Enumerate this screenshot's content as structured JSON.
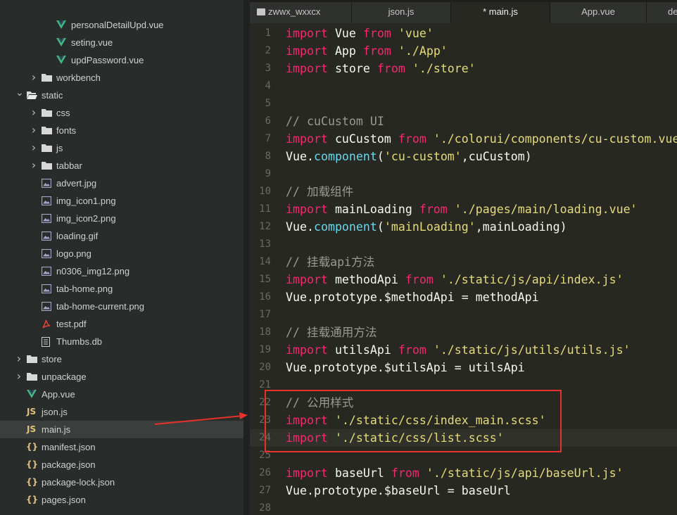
{
  "sidebar": {
    "items": [
      {
        "label": "personalDetailUpd.vue",
        "icon": "vue-icon",
        "indent": 3,
        "arrow": ""
      },
      {
        "label": "seting.vue",
        "icon": "vue-icon",
        "indent": 3,
        "arrow": ""
      },
      {
        "label": "updPassword.vue",
        "icon": "vue-icon",
        "indent": 3,
        "arrow": ""
      },
      {
        "label": "workbench",
        "icon": "folder-icon",
        "indent": 2,
        "arrow": "right"
      },
      {
        "label": "static",
        "icon": "folder-open-icon",
        "indent": 1,
        "arrow": "down"
      },
      {
        "label": "css",
        "icon": "folder-icon",
        "indent": 2,
        "arrow": "right"
      },
      {
        "label": "fonts",
        "icon": "folder-icon",
        "indent": 2,
        "arrow": "right"
      },
      {
        "label": "js",
        "icon": "folder-icon",
        "indent": 2,
        "arrow": "right"
      },
      {
        "label": "tabbar",
        "icon": "folder-icon",
        "indent": 2,
        "arrow": "right"
      },
      {
        "label": "advert.jpg",
        "icon": "image-icon",
        "indent": 2,
        "arrow": ""
      },
      {
        "label": "img_icon1.png",
        "icon": "image-icon",
        "indent": 2,
        "arrow": ""
      },
      {
        "label": "img_icon2.png",
        "icon": "image-icon",
        "indent": 2,
        "arrow": ""
      },
      {
        "label": "loading.gif",
        "icon": "image-icon",
        "indent": 2,
        "arrow": ""
      },
      {
        "label": "logo.png",
        "icon": "image-icon",
        "indent": 2,
        "arrow": ""
      },
      {
        "label": "n0306_img12.png",
        "icon": "image-icon",
        "indent": 2,
        "arrow": ""
      },
      {
        "label": "tab-home.png",
        "icon": "image-icon",
        "indent": 2,
        "arrow": ""
      },
      {
        "label": "tab-home-current.png",
        "icon": "image-icon",
        "indent": 2,
        "arrow": ""
      },
      {
        "label": "test.pdf",
        "icon": "pdf-icon",
        "indent": 2,
        "arrow": ""
      },
      {
        "label": "Thumbs.db",
        "icon": "file-icon",
        "indent": 2,
        "arrow": ""
      },
      {
        "label": "store",
        "icon": "folder-icon",
        "indent": 1,
        "arrow": "right"
      },
      {
        "label": "unpackage",
        "icon": "folder-icon",
        "indent": 1,
        "arrow": "right"
      },
      {
        "label": "App.vue",
        "icon": "vue-icon",
        "indent": 1,
        "arrow": ""
      },
      {
        "label": "json.js",
        "icon": "js-icon",
        "indent": 1,
        "arrow": ""
      },
      {
        "label": "main.js",
        "icon": "js-icon",
        "indent": 1,
        "arrow": "",
        "selected": true
      },
      {
        "label": "manifest.json",
        "icon": "json-icon",
        "indent": 1,
        "arrow": ""
      },
      {
        "label": "package.json",
        "icon": "json-icon",
        "indent": 1,
        "arrow": ""
      },
      {
        "label": "package-lock.json",
        "icon": "json-icon",
        "indent": 1,
        "arrow": ""
      },
      {
        "label": "pages.json",
        "icon": "json-icon",
        "indent": 1,
        "arrow": ""
      }
    ]
  },
  "tabs": [
    {
      "label": "zwwx_wxxcx",
      "icon": "folder-icon",
      "active": false
    },
    {
      "label": "json.js",
      "icon": "",
      "active": false
    },
    {
      "label": "* main.js",
      "icon": "",
      "active": true
    },
    {
      "label": "App.vue",
      "icon": "",
      "active": false
    },
    {
      "label": "de",
      "icon": "",
      "active": false
    }
  ],
  "editor": {
    "active_line": 24,
    "lines": [
      {
        "n": "1",
        "t": [
          [
            "kw",
            "import"
          ],
          [
            "p",
            " Vue "
          ],
          [
            "kw",
            "from"
          ],
          [
            "p",
            " "
          ],
          [
            "str",
            "'vue'"
          ]
        ]
      },
      {
        "n": "2",
        "t": [
          [
            "kw",
            "import"
          ],
          [
            "p",
            " App "
          ],
          [
            "kw",
            "from"
          ],
          [
            "p",
            " "
          ],
          [
            "str",
            "'./App'"
          ]
        ]
      },
      {
        "n": "3",
        "t": [
          [
            "kw",
            "import"
          ],
          [
            "p",
            " store "
          ],
          [
            "kw",
            "from"
          ],
          [
            "p",
            " "
          ],
          [
            "str",
            "'./store'"
          ]
        ]
      },
      {
        "n": "4",
        "t": []
      },
      {
        "n": "5",
        "t": []
      },
      {
        "n": "6",
        "t": [
          [
            "cm",
            "// cuCustom UI"
          ]
        ]
      },
      {
        "n": "7",
        "t": [
          [
            "kw",
            "import"
          ],
          [
            "p",
            " cuCustom "
          ],
          [
            "kw",
            "from"
          ],
          [
            "p",
            " "
          ],
          [
            "str",
            "'./colorui/components/cu-custom.vue'"
          ]
        ]
      },
      {
        "n": "8",
        "t": [
          [
            "p",
            "Vue."
          ],
          [
            "fn",
            "component"
          ],
          [
            "p",
            "("
          ],
          [
            "str",
            "'cu-custom'"
          ],
          [
            "p",
            ",cuCustom)"
          ]
        ]
      },
      {
        "n": "9",
        "t": []
      },
      {
        "n": "10",
        "t": [
          [
            "cm",
            "// 加载组件"
          ]
        ]
      },
      {
        "n": "11",
        "t": [
          [
            "kw",
            "import"
          ],
          [
            "p",
            " mainLoading "
          ],
          [
            "kw",
            "from"
          ],
          [
            "p",
            " "
          ],
          [
            "str",
            "'./pages/main/loading.vue'"
          ]
        ]
      },
      {
        "n": "12",
        "t": [
          [
            "p",
            "Vue."
          ],
          [
            "fn",
            "component"
          ],
          [
            "p",
            "("
          ],
          [
            "str",
            "'mainLoading'"
          ],
          [
            "p",
            ",mainLoading)"
          ]
        ]
      },
      {
        "n": "13",
        "t": []
      },
      {
        "n": "14",
        "t": [
          [
            "cm",
            "// 挂载api方法"
          ]
        ]
      },
      {
        "n": "15",
        "t": [
          [
            "kw",
            "import"
          ],
          [
            "p",
            " methodApi "
          ],
          [
            "kw",
            "from"
          ],
          [
            "p",
            " "
          ],
          [
            "str",
            "'./static/js/api/index.js'"
          ]
        ]
      },
      {
        "n": "16",
        "t": [
          [
            "p",
            "Vue.prototype.$methodApi = methodApi"
          ]
        ]
      },
      {
        "n": "17",
        "t": []
      },
      {
        "n": "18",
        "t": [
          [
            "cm",
            "// 挂载通用方法"
          ]
        ]
      },
      {
        "n": "19",
        "t": [
          [
            "kw",
            "import"
          ],
          [
            "p",
            " utilsApi "
          ],
          [
            "kw",
            "from"
          ],
          [
            "p",
            " "
          ],
          [
            "str",
            "'./static/js/utils/utils.js'"
          ]
        ]
      },
      {
        "n": "20",
        "t": [
          [
            "p",
            "Vue.prototype.$utilsApi = utilsApi"
          ]
        ]
      },
      {
        "n": "21",
        "t": []
      },
      {
        "n": "22",
        "t": [
          [
            "cm",
            "// 公用样式"
          ]
        ]
      },
      {
        "n": "23",
        "t": [
          [
            "kw",
            "import"
          ],
          [
            "p",
            " "
          ],
          [
            "str",
            "'./static/css/index_main.scss'"
          ]
        ]
      },
      {
        "n": "24",
        "t": [
          [
            "kw",
            "import"
          ],
          [
            "p",
            " "
          ],
          [
            "str",
            "'./static/css/list.scss'"
          ]
        ]
      },
      {
        "n": "25",
        "t": []
      },
      {
        "n": "26",
        "t": [
          [
            "kw",
            "import"
          ],
          [
            "p",
            " baseUrl "
          ],
          [
            "kw",
            "from"
          ],
          [
            "p",
            " "
          ],
          [
            "str",
            "'./static/js/api/baseUrl.js'"
          ]
        ]
      },
      {
        "n": "27",
        "t": [
          [
            "p",
            "Vue.prototype.$baseUrl = baseUrl"
          ]
        ]
      },
      {
        "n": "28",
        "t": []
      }
    ]
  },
  "colors": {
    "annotation": "#e8312a",
    "keyword": "#f92672",
    "string": "#e6db74",
    "function": "#66d9ef",
    "comment": "#9a9a8e",
    "vue": "#41b883",
    "js": "#e5c07b",
    "json": "#e5c07b"
  }
}
